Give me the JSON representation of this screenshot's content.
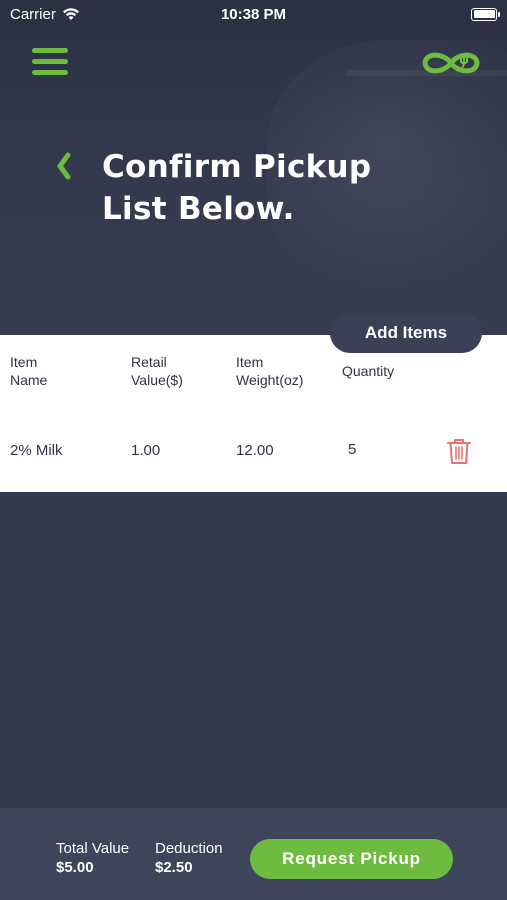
{
  "status_bar": {
    "carrier": "Carrier",
    "time": "10:38 PM"
  },
  "colors": {
    "accent": "#6dbb3f",
    "background": "#333a4d",
    "card": "#ffffff",
    "delete": "#e57373"
  },
  "icons": {
    "menu": "hamburger-icon",
    "logo": "infinity-fork-logo-icon",
    "back": "chevron-left-icon",
    "delete": "trash-icon"
  },
  "header": {
    "title": "Confirm Pickup List Below."
  },
  "add_items_label": "Add Items",
  "table": {
    "headers": [
      {
        "line1": "Item",
        "line2": "Name"
      },
      {
        "line1": "Retail",
        "line2": "Value($)"
      },
      {
        "line1": "Item",
        "line2": "Weight(oz)"
      },
      {
        "line1": "Quantity",
        "line2": ""
      }
    ],
    "rows": [
      {
        "name": "2% Milk",
        "retail_value": "1.00",
        "weight": "12.00",
        "quantity": "5"
      }
    ]
  },
  "summary": {
    "total_label": "Total Value",
    "total_value": "$5.00",
    "deduction_label": "Deduction",
    "deduction_value": "$2.50"
  },
  "request_pickup_label": "Request Pickup"
}
